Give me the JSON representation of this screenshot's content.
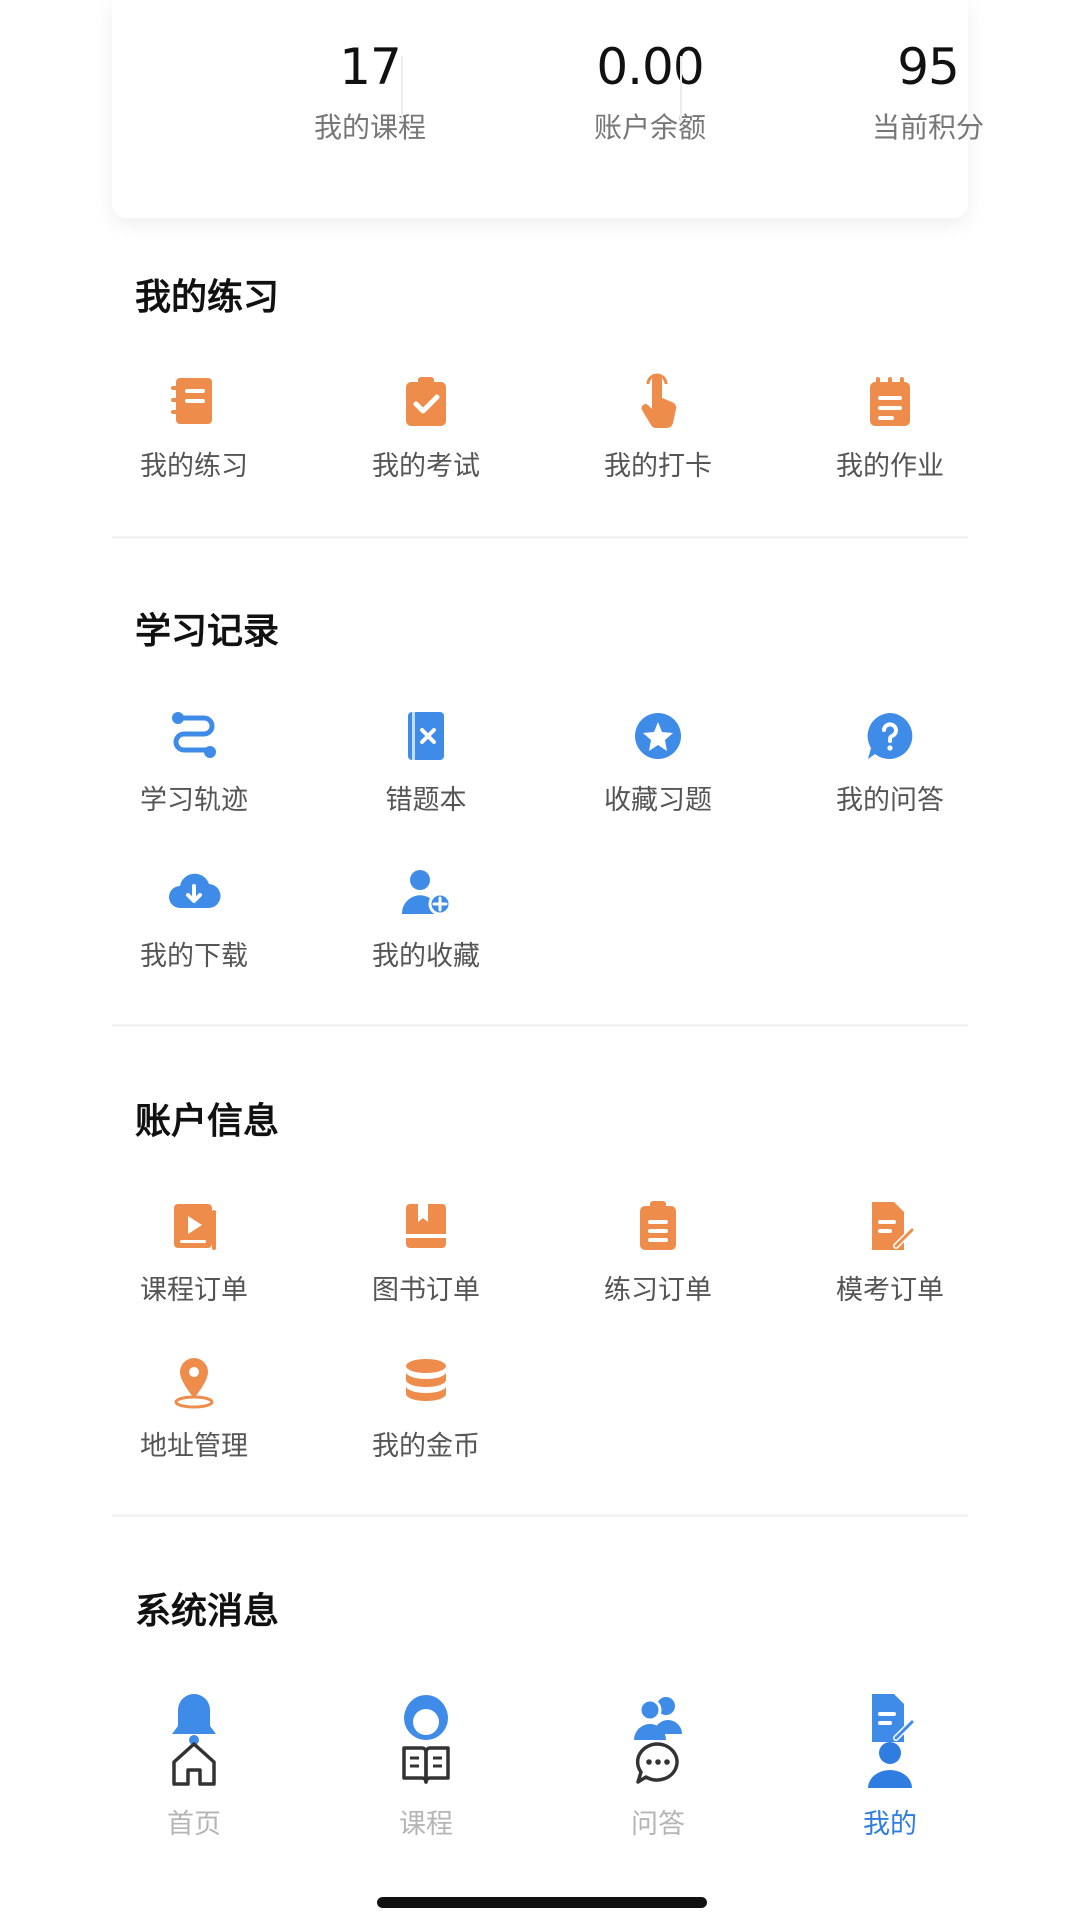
{
  "stats": [
    {
      "value": "17",
      "label": "我的课程"
    },
    {
      "value": "0.00",
      "label": "账户余额"
    },
    {
      "value": "95",
      "label": "当前积分"
    }
  ],
  "sections": {
    "practice": {
      "title": "我的练习",
      "items": [
        {
          "label": "我的练习",
          "icon": "notebook-icon"
        },
        {
          "label": "我的考试",
          "icon": "clipboard-check-icon"
        },
        {
          "label": "我的打卡",
          "icon": "tap-hand-icon"
        },
        {
          "label": "我的作业",
          "icon": "notepad-icon"
        }
      ]
    },
    "records": {
      "title": "学习记录",
      "items": [
        {
          "label": "学习轨迹",
          "icon": "route-icon"
        },
        {
          "label": "错题本",
          "icon": "wrong-book-icon"
        },
        {
          "label": "收藏习题",
          "icon": "star-circle-icon"
        },
        {
          "label": "我的问答",
          "icon": "question-bubble-icon"
        },
        {
          "label": "我的下载",
          "icon": "cloud-download-icon"
        },
        {
          "label": "我的收藏",
          "icon": "user-favorite-icon"
        }
      ]
    },
    "account": {
      "title": "账户信息",
      "items": [
        {
          "label": "课程订单",
          "icon": "video-order-icon"
        },
        {
          "label": "图书订单",
          "icon": "book-order-icon"
        },
        {
          "label": "练习订单",
          "icon": "clipboard-order-icon"
        },
        {
          "label": "模考订单",
          "icon": "document-edit-icon"
        },
        {
          "label": "地址管理",
          "icon": "location-pin-icon"
        },
        {
          "label": "我的金币",
          "icon": "coin-stack-icon"
        }
      ]
    },
    "messages": {
      "title": "系统消息",
      "items": [
        {
          "icon": "bell-icon"
        },
        {
          "icon": "support-agent-icon"
        },
        {
          "icon": "users-icon"
        },
        {
          "icon": "document-pen-icon"
        }
      ]
    }
  },
  "tabbar": [
    {
      "label": "首页",
      "icon": "home-icon",
      "active": false
    },
    {
      "label": "课程",
      "icon": "open-book-icon",
      "active": false
    },
    {
      "label": "问答",
      "icon": "chat-bubble-icon",
      "active": false
    },
    {
      "label": "我的",
      "icon": "person-icon",
      "active": true
    }
  ],
  "colors": {
    "orange": "#EE8C4B",
    "blue": "#3F8BE8",
    "active_tab": "#2F7DE1",
    "inactive_tab": "#B5B5B5"
  }
}
